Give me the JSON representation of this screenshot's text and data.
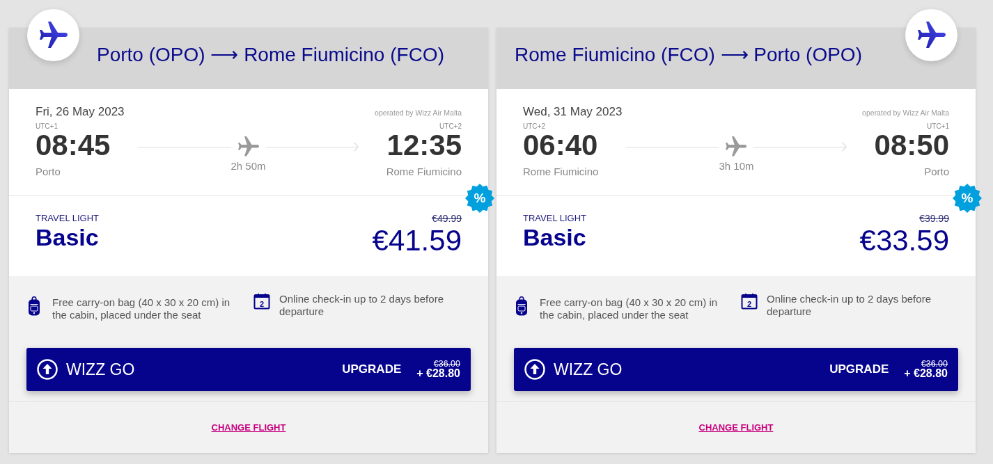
{
  "cards": [
    {
      "kind": "left",
      "route_title": "Porto (OPO) ⟶ Rome Fiumicino (FCO)",
      "flight": {
        "date": "Fri, 26 May 2023",
        "operator": "operated by Wizz Air Malta",
        "departure": {
          "utc": "UTC+1",
          "time": "08:45",
          "city": "Porto"
        },
        "duration": "2h 50m",
        "arrival": {
          "utc": "UTC+2",
          "time": "12:35",
          "city": "Rome Fiumicino"
        }
      },
      "fare": {
        "tag": "TRAVEL LIGHT",
        "name": "Basic",
        "old_price": "€49.99",
        "price": "€41.59",
        "discount_badge": "%"
      },
      "features": [
        {
          "kind": "bag",
          "text": "Free carry-on bag (40 x 30 x 20 cm) in the cabin, placed under the seat"
        },
        {
          "kind": "calendar",
          "icon_label": "2",
          "text": "Online check-in up to 2 days before departure"
        }
      ],
      "upgrade": {
        "bundle": "WIZZ GO",
        "action": "UPGRADE",
        "old_price": "€36.00",
        "price": "+ €28.80"
      },
      "change_link": "CHANGE FLIGHT"
    },
    {
      "kind": "right",
      "route_title": "Rome Fiumicino (FCO) ⟶ Porto (OPO)",
      "flight": {
        "date": "Wed, 31 May 2023",
        "operator": "operated by Wizz Air Malta",
        "departure": {
          "utc": "UTC+2",
          "time": "06:40",
          "city": "Rome Fiumicino"
        },
        "duration": "3h 10m",
        "arrival": {
          "utc": "UTC+1",
          "time": "08:50",
          "city": "Porto"
        }
      },
      "fare": {
        "tag": "TRAVEL LIGHT",
        "name": "Basic",
        "old_price": "€39.99",
        "price": "€33.59",
        "discount_badge": "%"
      },
      "features": [
        {
          "kind": "bag",
          "text": "Free carry-on bag (40 x 30 x 20 cm) in the cabin, placed under the seat"
        },
        {
          "kind": "calendar",
          "icon_label": "2",
          "text": "Online check-in up to 2 days before departure"
        }
      ],
      "upgrade": {
        "bundle": "WIZZ GO",
        "action": "UPGRADE",
        "old_price": "€36.00",
        "price": "+ €28.80"
      },
      "change_link": "CHANGE FLIGHT"
    }
  ]
}
